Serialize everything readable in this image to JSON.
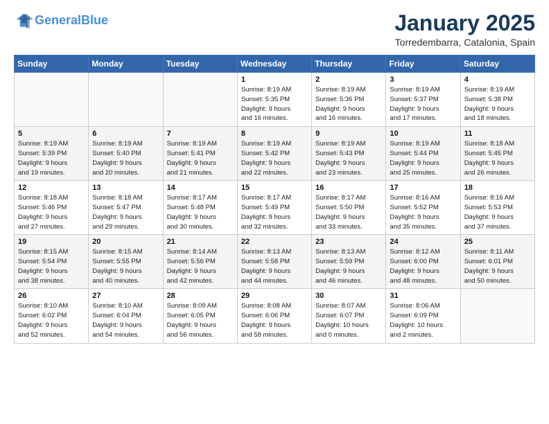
{
  "header": {
    "logo_line1": "General",
    "logo_line2": "Blue",
    "month_title": "January 2025",
    "location": "Torredembarra, Catalonia, Spain"
  },
  "weekdays": [
    "Sunday",
    "Monday",
    "Tuesday",
    "Wednesday",
    "Thursday",
    "Friday",
    "Saturday"
  ],
  "weeks": [
    [
      {
        "day": "",
        "info": ""
      },
      {
        "day": "",
        "info": ""
      },
      {
        "day": "",
        "info": ""
      },
      {
        "day": "1",
        "info": "Sunrise: 8:19 AM\nSunset: 5:35 PM\nDaylight: 9 hours\nand 16 minutes."
      },
      {
        "day": "2",
        "info": "Sunrise: 8:19 AM\nSunset: 5:36 PM\nDaylight: 9 hours\nand 16 minutes."
      },
      {
        "day": "3",
        "info": "Sunrise: 8:19 AM\nSunset: 5:37 PM\nDaylight: 9 hours\nand 17 minutes."
      },
      {
        "day": "4",
        "info": "Sunrise: 8:19 AM\nSunset: 5:38 PM\nDaylight: 9 hours\nand 18 minutes."
      }
    ],
    [
      {
        "day": "5",
        "info": "Sunrise: 8:19 AM\nSunset: 5:39 PM\nDaylight: 9 hours\nand 19 minutes."
      },
      {
        "day": "6",
        "info": "Sunrise: 8:19 AM\nSunset: 5:40 PM\nDaylight: 9 hours\nand 20 minutes."
      },
      {
        "day": "7",
        "info": "Sunrise: 8:19 AM\nSunset: 5:41 PM\nDaylight: 9 hours\nand 21 minutes."
      },
      {
        "day": "8",
        "info": "Sunrise: 8:19 AM\nSunset: 5:42 PM\nDaylight: 9 hours\nand 22 minutes."
      },
      {
        "day": "9",
        "info": "Sunrise: 8:19 AM\nSunset: 5:43 PM\nDaylight: 9 hours\nand 23 minutes."
      },
      {
        "day": "10",
        "info": "Sunrise: 8:19 AM\nSunset: 5:44 PM\nDaylight: 9 hours\nand 25 minutes."
      },
      {
        "day": "11",
        "info": "Sunrise: 8:18 AM\nSunset: 5:45 PM\nDaylight: 9 hours\nand 26 minutes."
      }
    ],
    [
      {
        "day": "12",
        "info": "Sunrise: 8:18 AM\nSunset: 5:46 PM\nDaylight: 9 hours\nand 27 minutes."
      },
      {
        "day": "13",
        "info": "Sunrise: 8:18 AM\nSunset: 5:47 PM\nDaylight: 9 hours\nand 29 minutes."
      },
      {
        "day": "14",
        "info": "Sunrise: 8:17 AM\nSunset: 5:48 PM\nDaylight: 9 hours\nand 30 minutes."
      },
      {
        "day": "15",
        "info": "Sunrise: 8:17 AM\nSunset: 5:49 PM\nDaylight: 9 hours\nand 32 minutes."
      },
      {
        "day": "16",
        "info": "Sunrise: 8:17 AM\nSunset: 5:50 PM\nDaylight: 9 hours\nand 33 minutes."
      },
      {
        "day": "17",
        "info": "Sunrise: 8:16 AM\nSunset: 5:52 PM\nDaylight: 9 hours\nand 35 minutes."
      },
      {
        "day": "18",
        "info": "Sunrise: 8:16 AM\nSunset: 5:53 PM\nDaylight: 9 hours\nand 37 minutes."
      }
    ],
    [
      {
        "day": "19",
        "info": "Sunrise: 8:15 AM\nSunset: 5:54 PM\nDaylight: 9 hours\nand 38 minutes."
      },
      {
        "day": "20",
        "info": "Sunrise: 8:15 AM\nSunset: 5:55 PM\nDaylight: 9 hours\nand 40 minutes."
      },
      {
        "day": "21",
        "info": "Sunrise: 8:14 AM\nSunset: 5:56 PM\nDaylight: 9 hours\nand 42 minutes."
      },
      {
        "day": "22",
        "info": "Sunrise: 8:13 AM\nSunset: 5:58 PM\nDaylight: 9 hours\nand 44 minutes."
      },
      {
        "day": "23",
        "info": "Sunrise: 8:13 AM\nSunset: 5:59 PM\nDaylight: 9 hours\nand 46 minutes."
      },
      {
        "day": "24",
        "info": "Sunrise: 8:12 AM\nSunset: 6:00 PM\nDaylight: 9 hours\nand 48 minutes."
      },
      {
        "day": "25",
        "info": "Sunrise: 8:11 AM\nSunset: 6:01 PM\nDaylight: 9 hours\nand 50 minutes."
      }
    ],
    [
      {
        "day": "26",
        "info": "Sunrise: 8:10 AM\nSunset: 6:02 PM\nDaylight: 9 hours\nand 52 minutes."
      },
      {
        "day": "27",
        "info": "Sunrise: 8:10 AM\nSunset: 6:04 PM\nDaylight: 9 hours\nand 54 minutes."
      },
      {
        "day": "28",
        "info": "Sunrise: 8:09 AM\nSunset: 6:05 PM\nDaylight: 9 hours\nand 56 minutes."
      },
      {
        "day": "29",
        "info": "Sunrise: 8:08 AM\nSunset: 6:06 PM\nDaylight: 9 hours\nand 58 minutes."
      },
      {
        "day": "30",
        "info": "Sunrise: 8:07 AM\nSunset: 6:07 PM\nDaylight: 10 hours\nand 0 minutes."
      },
      {
        "day": "31",
        "info": "Sunrise: 8:06 AM\nSunset: 6:09 PM\nDaylight: 10 hours\nand 2 minutes."
      },
      {
        "day": "",
        "info": ""
      }
    ]
  ]
}
